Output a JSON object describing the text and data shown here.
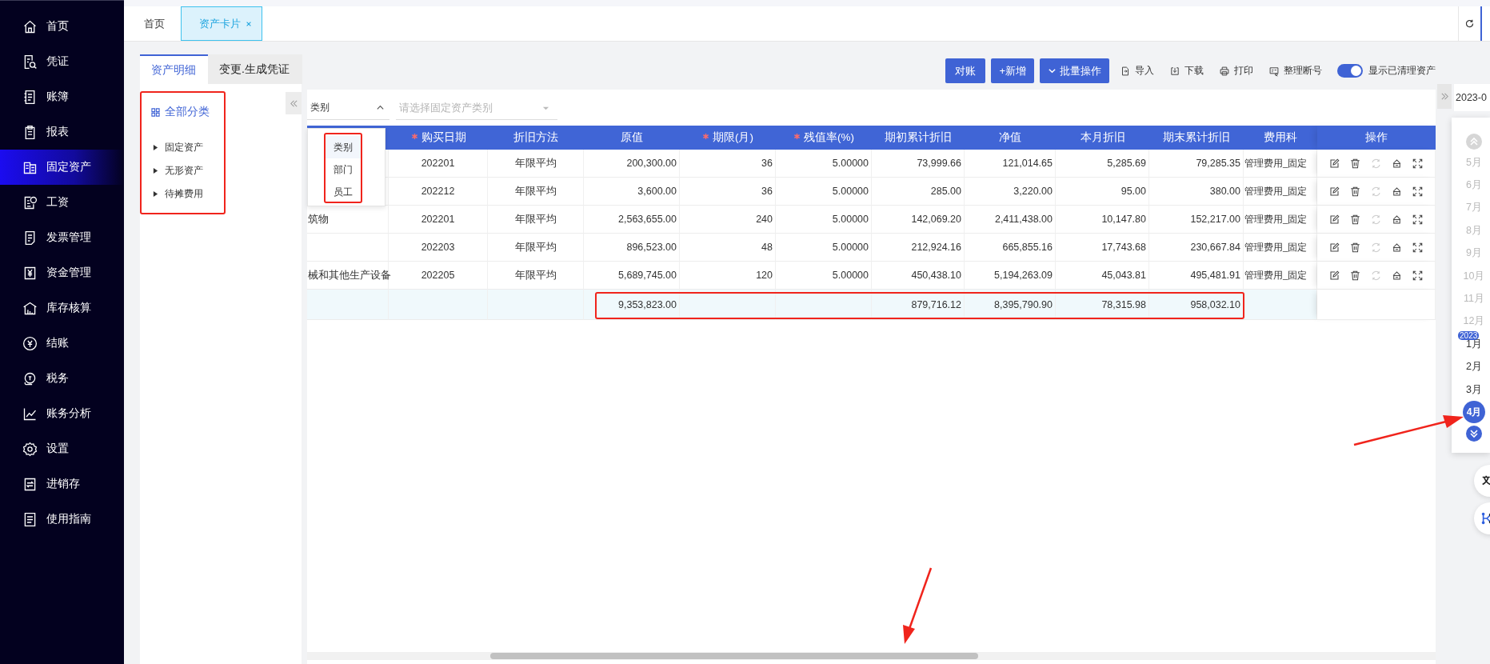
{
  "sidebar": {
    "items": [
      {
        "label": "首页",
        "selected": false
      },
      {
        "label": "凭证",
        "selected": false
      },
      {
        "label": "账簿",
        "selected": false
      },
      {
        "label": "报表",
        "selected": false
      },
      {
        "label": "固定资产",
        "selected": true
      },
      {
        "label": "工资",
        "selected": false
      },
      {
        "label": "发票管理",
        "selected": false
      },
      {
        "label": "资金管理",
        "selected": false
      },
      {
        "label": "库存核算",
        "selected": false
      },
      {
        "label": "结账",
        "selected": false
      },
      {
        "label": "税务",
        "selected": false
      },
      {
        "label": "账务分析",
        "selected": false
      },
      {
        "label": "设置",
        "selected": false
      },
      {
        "label": "进销存",
        "selected": false
      },
      {
        "label": "使用指南",
        "selected": false
      }
    ]
  },
  "tabs": [
    {
      "label": "首页",
      "selected": false,
      "closable": false
    },
    {
      "label": "资产卡片",
      "selected": true,
      "closable": true
    }
  ],
  "subtabs": [
    {
      "label": "资产明细",
      "selected": true
    },
    {
      "label": "变更.生成凭证",
      "selected": false
    }
  ],
  "toolbar": {
    "buttons": [
      {
        "label": "对账",
        "kind": "primary"
      },
      {
        "label": "+新增",
        "kind": "primary"
      },
      {
        "label": "批量操作",
        "kind": "dropdown"
      },
      {
        "label": "导入",
        "kind": "link"
      },
      {
        "label": "下载",
        "kind": "link"
      },
      {
        "label": "打印",
        "kind": "link"
      },
      {
        "label": "整理断号",
        "kind": "link"
      }
    ],
    "toggle": {
      "label": "显示已清理资产",
      "on": true
    }
  },
  "tree": {
    "title": "全部分类",
    "items": [
      {
        "label": "固定资产",
        "expanded": false
      },
      {
        "label": "无形资产",
        "expanded": false
      },
      {
        "label": "待摊费用",
        "expanded": false
      }
    ]
  },
  "filter": {
    "group_by": {
      "value": "类别",
      "expanded": true,
      "options": [
        {
          "label": "类别",
          "selected": true
        },
        {
          "label": "部门",
          "selected": false
        },
        {
          "label": "员工",
          "selected": false
        }
      ]
    },
    "category": {
      "placeholder": "请选择固定资产类别"
    }
  },
  "table": {
    "columns": [
      {},
      {
        "label": "购买日期",
        "required": true
      },
      {
        "label": "折旧方法",
        "required": false
      },
      {
        "label": "原值",
        "required": false
      },
      {
        "label": "期限(月)",
        "required": true
      },
      {
        "label": "残值率(%)",
        "required": true
      },
      {
        "label": "期初累计折旧",
        "required": false
      },
      {
        "label": "净值",
        "required": false
      },
      {
        "label": "本月折旧",
        "required": false
      },
      {
        "label": "期末累计折旧",
        "required": false
      },
      {
        "label": "费用科",
        "required": false
      },
      {
        "label": "操作",
        "required": false
      }
    ],
    "rows": [
      {
        "cells": [
          null,
          "202201",
          "年限平均",
          "200,300.00",
          "36",
          "5.00000",
          "73,999.66",
          "121,014.65",
          "5,285.69",
          "79,285.35",
          "管理费用_固定"
        ]
      },
      {
        "cells": [
          null,
          "202212",
          "年限平均",
          "3,600.00",
          "36",
          "5.00000",
          "285.00",
          "3,220.00",
          "95.00",
          "380.00",
          "管理费用_固定"
        ]
      },
      {
        "cells": [
          "筑物",
          "202201",
          "年限平均",
          "2,563,655.00",
          "240",
          "5.00000",
          "142,069.20",
          "2,411,438.00",
          "10,147.80",
          "152,217.00",
          "管理费用_固定"
        ]
      },
      {
        "cells": [
          null,
          "202203",
          "年限平均",
          "896,523.00",
          "48",
          "5.00000",
          "212,924.16",
          "665,855.16",
          "17,743.68",
          "230,667.84",
          "管理费用_固定"
        ]
      },
      {
        "cells": [
          "械和其他生产设备",
          "202205",
          "年限平均",
          "5,689,745.00",
          "120",
          "5.00000",
          "450,438.10",
          "5,194,263.09",
          "45,043.81",
          "495,481.91",
          "管理费用_固定"
        ]
      }
    ],
    "total": {
      "cells": [
        null,
        null,
        null,
        "9,353,823.00",
        null,
        null,
        "879,716.12",
        "8,395,790.90",
        "78,315.98",
        "958,032.10",
        null
      ]
    },
    "actions": [
      {
        "kind": "edit",
        "disabled": false
      },
      {
        "kind": "delete",
        "disabled": false
      },
      {
        "kind": "restore",
        "disabled": true
      },
      {
        "kind": "house",
        "disabled": false
      },
      {
        "kind": "expand",
        "disabled": false
      }
    ]
  },
  "calendar": {
    "date_value": "2023-0",
    "months": [
      {
        "label": "5月",
        "disabled": true,
        "selected": false
      },
      {
        "label": "6月",
        "disabled": true,
        "selected": false
      },
      {
        "label": "7月",
        "disabled": true,
        "selected": false
      },
      {
        "label": "8月",
        "disabled": true,
        "selected": false
      },
      {
        "label": "9月",
        "disabled": true,
        "selected": false
      },
      {
        "label": "10月",
        "disabled": true,
        "selected": false
      },
      {
        "label": "11月",
        "disabled": true,
        "selected": false
      },
      {
        "label": "12月",
        "disabled": true,
        "selected": false
      },
      {
        "label": "1月",
        "year": "2023",
        "disabled": false,
        "selected": false
      },
      {
        "label": "2月",
        "disabled": false,
        "selected": false
      },
      {
        "label": "3月",
        "disabled": false,
        "selected": false
      },
      {
        "label": "4月",
        "disabled": false,
        "selected": true
      }
    ]
  }
}
